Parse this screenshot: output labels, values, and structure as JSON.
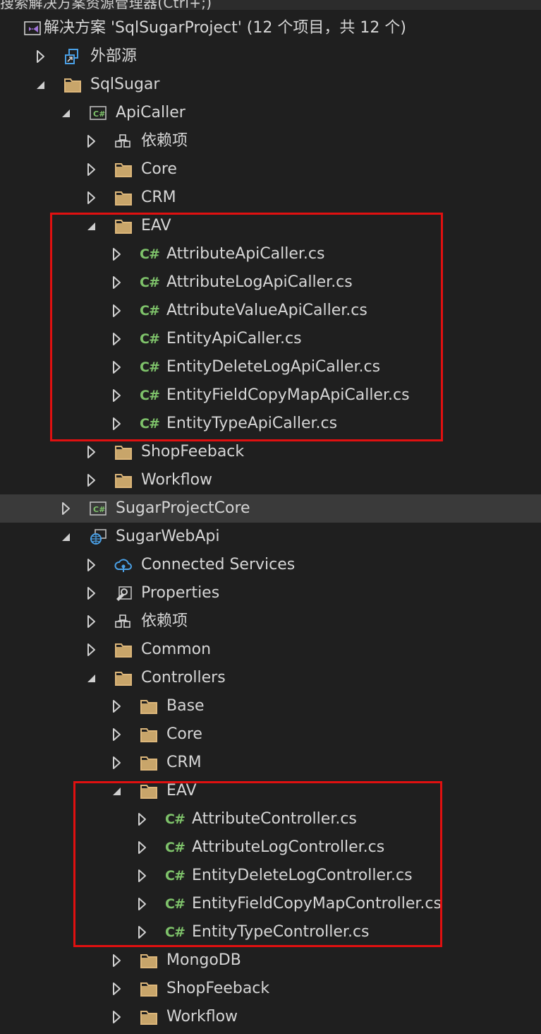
{
  "window": {
    "title": "搜索解决方案资源管理器(Ctrl+;)"
  },
  "tree": {
    "nodes": [
      {
        "label": "解决方案 'SqlSugarProject' (12 个项目，共 12 个)",
        "icon": "solution-icon",
        "expander": "none",
        "depth": 0
      },
      {
        "label": "外部源",
        "icon": "external-sources-icon",
        "expander": "collapsed",
        "depth": 1
      },
      {
        "label": "SqlSugar",
        "icon": "folder-icon",
        "expander": "expanded",
        "depth": 1
      },
      {
        "label": "ApiCaller",
        "icon": "csharp-project-icon",
        "expander": "expanded",
        "depth": 2
      },
      {
        "label": "依赖项",
        "icon": "dependencies-icon",
        "expander": "collapsed",
        "depth": 3
      },
      {
        "label": "Core",
        "icon": "folder-icon",
        "expander": "collapsed",
        "depth": 3
      },
      {
        "label": "CRM",
        "icon": "folder-icon",
        "expander": "collapsed",
        "depth": 3
      },
      {
        "label": "EAV",
        "icon": "folder-icon",
        "expander": "expanded",
        "depth": 3
      },
      {
        "label": "AttributeApiCaller.cs",
        "icon": "csharp-file-icon",
        "expander": "collapsed",
        "depth": 4
      },
      {
        "label": "AttributeLogApiCaller.cs",
        "icon": "csharp-file-icon",
        "expander": "collapsed",
        "depth": 4
      },
      {
        "label": "AttributeValueApiCaller.cs",
        "icon": "csharp-file-icon",
        "expander": "collapsed",
        "depth": 4
      },
      {
        "label": "EntityApiCaller.cs",
        "icon": "csharp-file-icon",
        "expander": "collapsed",
        "depth": 4
      },
      {
        "label": "EntityDeleteLogApiCaller.cs",
        "icon": "csharp-file-icon",
        "expander": "collapsed",
        "depth": 4
      },
      {
        "label": "EntityFieldCopyMapApiCaller.cs",
        "icon": "csharp-file-icon",
        "expander": "collapsed",
        "depth": 4
      },
      {
        "label": "EntityTypeApiCaller.cs",
        "icon": "csharp-file-icon",
        "expander": "collapsed",
        "depth": 4
      },
      {
        "label": "ShopFeeback",
        "icon": "folder-icon",
        "expander": "collapsed",
        "depth": 3
      },
      {
        "label": "Workflow",
        "icon": "folder-icon",
        "expander": "collapsed",
        "depth": 3
      },
      {
        "label": "SugarProjectCore",
        "icon": "csharp-project-icon",
        "expander": "collapsed",
        "depth": 2,
        "selected": true
      },
      {
        "label": "SugarWebApi",
        "icon": "web-project-icon",
        "expander": "expanded",
        "depth": 2
      },
      {
        "label": "Connected Services",
        "icon": "connected-services-icon",
        "expander": "collapsed",
        "depth": 3
      },
      {
        "label": "Properties",
        "icon": "properties-icon",
        "expander": "collapsed",
        "depth": 3
      },
      {
        "label": "依赖项",
        "icon": "dependencies-icon",
        "expander": "collapsed",
        "depth": 3
      },
      {
        "label": "Common",
        "icon": "folder-icon",
        "expander": "collapsed",
        "depth": 3
      },
      {
        "label": "Controllers",
        "icon": "folder-icon",
        "expander": "expanded",
        "depth": 3
      },
      {
        "label": "Base",
        "icon": "folder-icon",
        "expander": "collapsed",
        "depth": 4
      },
      {
        "label": "Core",
        "icon": "folder-icon",
        "expander": "collapsed",
        "depth": 4
      },
      {
        "label": "CRM",
        "icon": "folder-icon",
        "expander": "collapsed",
        "depth": 4
      },
      {
        "label": "EAV",
        "icon": "folder-icon",
        "expander": "expanded",
        "depth": 4
      },
      {
        "label": "AttributeController.cs",
        "icon": "csharp-file-icon",
        "expander": "collapsed",
        "depth": 5
      },
      {
        "label": "AttributeLogController.cs",
        "icon": "csharp-file-icon",
        "expander": "collapsed",
        "depth": 5
      },
      {
        "label": "EntityDeleteLogController.cs",
        "icon": "csharp-file-icon",
        "expander": "collapsed",
        "depth": 5
      },
      {
        "label": "EntityFieldCopyMapController.cs",
        "icon": "csharp-file-icon",
        "expander": "collapsed",
        "depth": 5
      },
      {
        "label": "EntityTypeController.cs",
        "icon": "csharp-file-icon",
        "expander": "collapsed",
        "depth": 5
      },
      {
        "label": "MongoDB",
        "icon": "folder-icon",
        "expander": "collapsed",
        "depth": 4
      },
      {
        "label": "ShopFeeback",
        "icon": "folder-icon",
        "expander": "collapsed",
        "depth": 4
      },
      {
        "label": "Workflow",
        "icon": "folder-icon",
        "expander": "collapsed",
        "depth": 4
      }
    ],
    "csharp_glyph": "C#"
  },
  "colors": {
    "background": "#1f1f1f",
    "text": "#d6d6d6",
    "selected_row": "#3a3a3a",
    "highlight_box": "#e01010",
    "folder": "#dcb67a",
    "csharp": "#7ec26a"
  }
}
